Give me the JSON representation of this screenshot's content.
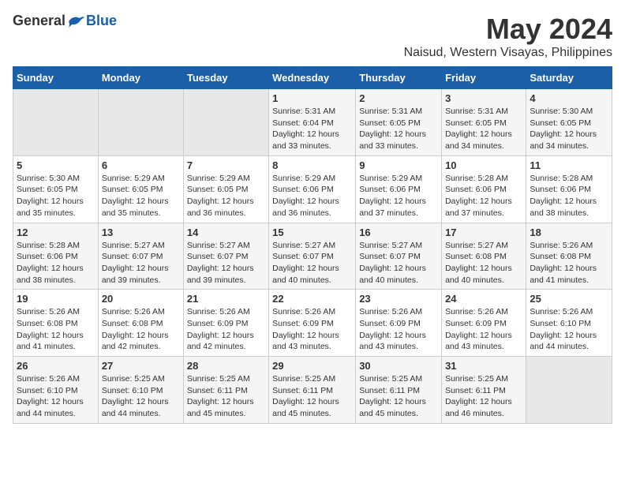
{
  "logo": {
    "general": "General",
    "blue": "Blue"
  },
  "title": "May 2024",
  "subtitle": "Naisud, Western Visayas, Philippines",
  "calendar": {
    "headers": [
      "Sunday",
      "Monday",
      "Tuesday",
      "Wednesday",
      "Thursday",
      "Friday",
      "Saturday"
    ],
    "weeks": [
      [
        {
          "day": "",
          "info": ""
        },
        {
          "day": "",
          "info": ""
        },
        {
          "day": "",
          "info": ""
        },
        {
          "day": "1",
          "info": "Sunrise: 5:31 AM\nSunset: 6:04 PM\nDaylight: 12 hours\nand 33 minutes."
        },
        {
          "day": "2",
          "info": "Sunrise: 5:31 AM\nSunset: 6:05 PM\nDaylight: 12 hours\nand 33 minutes."
        },
        {
          "day": "3",
          "info": "Sunrise: 5:31 AM\nSunset: 6:05 PM\nDaylight: 12 hours\nand 34 minutes."
        },
        {
          "day": "4",
          "info": "Sunrise: 5:30 AM\nSunset: 6:05 PM\nDaylight: 12 hours\nand 34 minutes."
        }
      ],
      [
        {
          "day": "5",
          "info": "Sunrise: 5:30 AM\nSunset: 6:05 PM\nDaylight: 12 hours\nand 35 minutes."
        },
        {
          "day": "6",
          "info": "Sunrise: 5:29 AM\nSunset: 6:05 PM\nDaylight: 12 hours\nand 35 minutes."
        },
        {
          "day": "7",
          "info": "Sunrise: 5:29 AM\nSunset: 6:05 PM\nDaylight: 12 hours\nand 36 minutes."
        },
        {
          "day": "8",
          "info": "Sunrise: 5:29 AM\nSunset: 6:06 PM\nDaylight: 12 hours\nand 36 minutes."
        },
        {
          "day": "9",
          "info": "Sunrise: 5:29 AM\nSunset: 6:06 PM\nDaylight: 12 hours\nand 37 minutes."
        },
        {
          "day": "10",
          "info": "Sunrise: 5:28 AM\nSunset: 6:06 PM\nDaylight: 12 hours\nand 37 minutes."
        },
        {
          "day": "11",
          "info": "Sunrise: 5:28 AM\nSunset: 6:06 PM\nDaylight: 12 hours\nand 38 minutes."
        }
      ],
      [
        {
          "day": "12",
          "info": "Sunrise: 5:28 AM\nSunset: 6:06 PM\nDaylight: 12 hours\nand 38 minutes."
        },
        {
          "day": "13",
          "info": "Sunrise: 5:27 AM\nSunset: 6:07 PM\nDaylight: 12 hours\nand 39 minutes."
        },
        {
          "day": "14",
          "info": "Sunrise: 5:27 AM\nSunset: 6:07 PM\nDaylight: 12 hours\nand 39 minutes."
        },
        {
          "day": "15",
          "info": "Sunrise: 5:27 AM\nSunset: 6:07 PM\nDaylight: 12 hours\nand 40 minutes."
        },
        {
          "day": "16",
          "info": "Sunrise: 5:27 AM\nSunset: 6:07 PM\nDaylight: 12 hours\nand 40 minutes."
        },
        {
          "day": "17",
          "info": "Sunrise: 5:27 AM\nSunset: 6:08 PM\nDaylight: 12 hours\nand 40 minutes."
        },
        {
          "day": "18",
          "info": "Sunrise: 5:26 AM\nSunset: 6:08 PM\nDaylight: 12 hours\nand 41 minutes."
        }
      ],
      [
        {
          "day": "19",
          "info": "Sunrise: 5:26 AM\nSunset: 6:08 PM\nDaylight: 12 hours\nand 41 minutes."
        },
        {
          "day": "20",
          "info": "Sunrise: 5:26 AM\nSunset: 6:08 PM\nDaylight: 12 hours\nand 42 minutes."
        },
        {
          "day": "21",
          "info": "Sunrise: 5:26 AM\nSunset: 6:09 PM\nDaylight: 12 hours\nand 42 minutes."
        },
        {
          "day": "22",
          "info": "Sunrise: 5:26 AM\nSunset: 6:09 PM\nDaylight: 12 hours\nand 43 minutes."
        },
        {
          "day": "23",
          "info": "Sunrise: 5:26 AM\nSunset: 6:09 PM\nDaylight: 12 hours\nand 43 minutes."
        },
        {
          "day": "24",
          "info": "Sunrise: 5:26 AM\nSunset: 6:09 PM\nDaylight: 12 hours\nand 43 minutes."
        },
        {
          "day": "25",
          "info": "Sunrise: 5:26 AM\nSunset: 6:10 PM\nDaylight: 12 hours\nand 44 minutes."
        }
      ],
      [
        {
          "day": "26",
          "info": "Sunrise: 5:26 AM\nSunset: 6:10 PM\nDaylight: 12 hours\nand 44 minutes."
        },
        {
          "day": "27",
          "info": "Sunrise: 5:25 AM\nSunset: 6:10 PM\nDaylight: 12 hours\nand 44 minutes."
        },
        {
          "day": "28",
          "info": "Sunrise: 5:25 AM\nSunset: 6:11 PM\nDaylight: 12 hours\nand 45 minutes."
        },
        {
          "day": "29",
          "info": "Sunrise: 5:25 AM\nSunset: 6:11 PM\nDaylight: 12 hours\nand 45 minutes."
        },
        {
          "day": "30",
          "info": "Sunrise: 5:25 AM\nSunset: 6:11 PM\nDaylight: 12 hours\nand 45 minutes."
        },
        {
          "day": "31",
          "info": "Sunrise: 5:25 AM\nSunset: 6:11 PM\nDaylight: 12 hours\nand 46 minutes."
        },
        {
          "day": "",
          "info": ""
        }
      ]
    ]
  }
}
